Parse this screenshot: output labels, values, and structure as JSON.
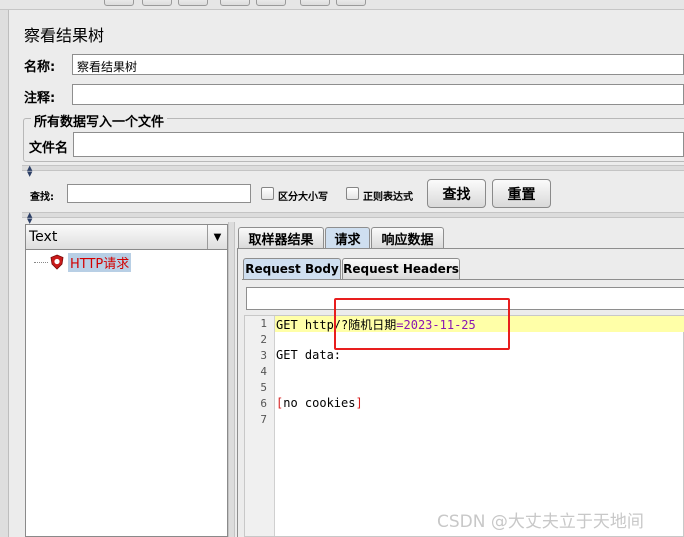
{
  "window": {
    "title": "察看结果树"
  },
  "form": {
    "name_label": "名称:",
    "name_value": "察看结果树",
    "comment_label": "注释:",
    "comment_value": "",
    "group_title": "所有数据写入一个文件",
    "filename_label": "文件名",
    "filename_value": ""
  },
  "search": {
    "label": "查找:",
    "value": "",
    "case_sensitive_label": "区分大小写",
    "regex_label": "正则表达式",
    "find_button": "查找",
    "reset_button": "重置"
  },
  "tree": {
    "renderer": "Text",
    "items": [
      {
        "label": "HTTP请求"
      }
    ]
  },
  "tabs": [
    {
      "label": "取样器结果",
      "active": false
    },
    {
      "label": "请求",
      "active": true
    },
    {
      "label": "响应数据",
      "active": false
    }
  ],
  "subtabs": [
    {
      "label": "Request Body",
      "active": true
    },
    {
      "label": "Request Headers",
      "active": false
    }
  ],
  "editor": {
    "line_numbers": [
      "1",
      "2",
      "3",
      "4",
      "5",
      "6",
      "7"
    ],
    "line1": {
      "prefix": "GET http",
      "middle": "/?",
      "param": "随机日期",
      "equals": "=",
      "value": "2023-11-25"
    },
    "line3": "GET data:",
    "line6": {
      "open": "[",
      "text": "no cookies",
      "close": "]"
    }
  },
  "watermark": "CSDN @大丈夫立于天地间",
  "colors": {
    "highlight_box": "#e81e1e",
    "error_text": "#d20000"
  }
}
